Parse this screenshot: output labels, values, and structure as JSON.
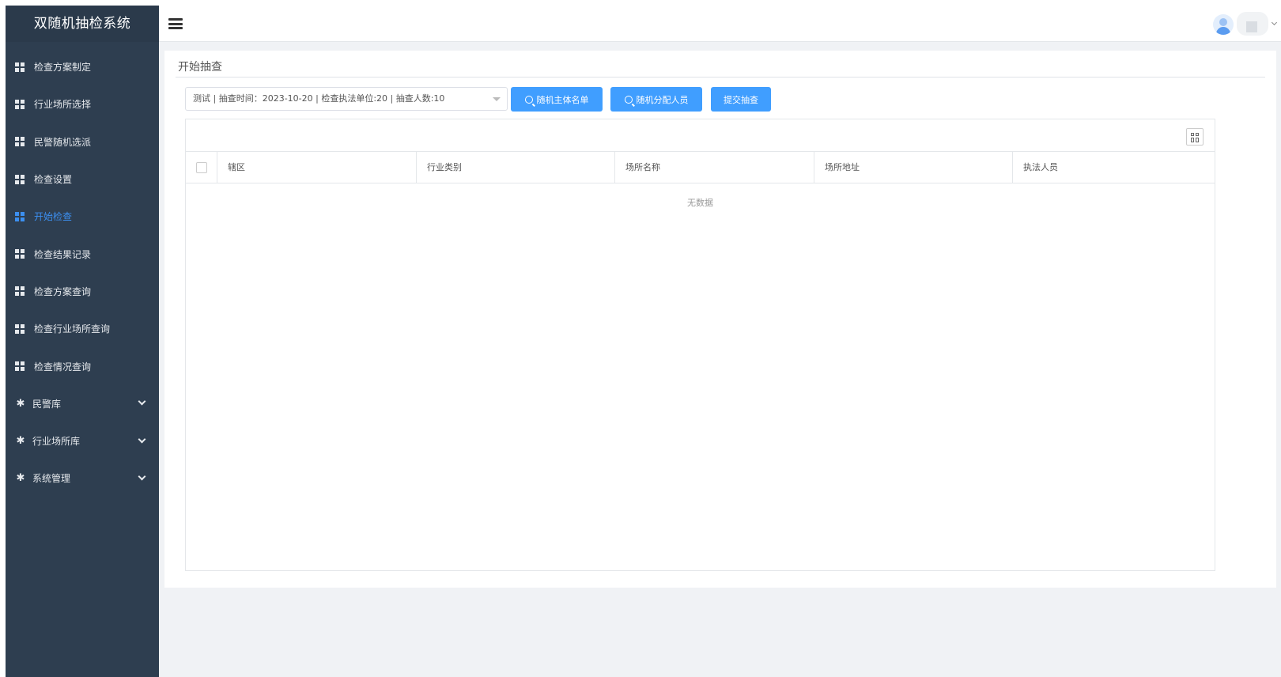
{
  "sidebar": {
    "brand": "双随机抽检系统",
    "items": [
      {
        "label": "检查方案制定",
        "icon": "grid-icon",
        "active": false
      },
      {
        "label": "行业场所选择",
        "icon": "grid-icon",
        "active": false
      },
      {
        "label": "民警随机选派",
        "icon": "grid-icon",
        "active": false
      },
      {
        "label": "检查设置",
        "icon": "grid-icon",
        "active": false
      },
      {
        "label": "开始检查",
        "icon": "grid-icon",
        "active": true
      },
      {
        "label": "检查结果记录",
        "icon": "grid-icon",
        "active": false
      },
      {
        "label": "检查方案查询",
        "icon": "grid-icon",
        "active": false
      },
      {
        "label": "检查行业场所查询",
        "icon": "grid-icon",
        "active": false
      },
      {
        "label": "检查情况查询",
        "icon": "grid-icon",
        "active": false
      }
    ],
    "groups": [
      {
        "label": "民警库",
        "icon": "gear-icon"
      },
      {
        "label": "行业场所库",
        "icon": "gear-icon"
      },
      {
        "label": "系统管理",
        "icon": "gear-icon"
      }
    ]
  },
  "main": {
    "title": "开始抽查",
    "select_value": "测试 | 抽查时间：2023-10-20 | 检查执法单位:20 | 抽查人数:10",
    "buttons": {
      "random_subjects": "随机主体名单",
      "random_assign": "随机分配人员",
      "submit": "提交抽查"
    },
    "table": {
      "columns": [
        "辖区",
        "行业类别",
        "场所名称",
        "场所地址",
        "执法人员"
      ],
      "rows": [],
      "empty_text": "无数据"
    }
  },
  "colors": {
    "sidebar_bg": "#2e3e50",
    "accent": "#409eff",
    "active_menu": "#3c8ff0",
    "page_bg": "#f0f2f5"
  }
}
